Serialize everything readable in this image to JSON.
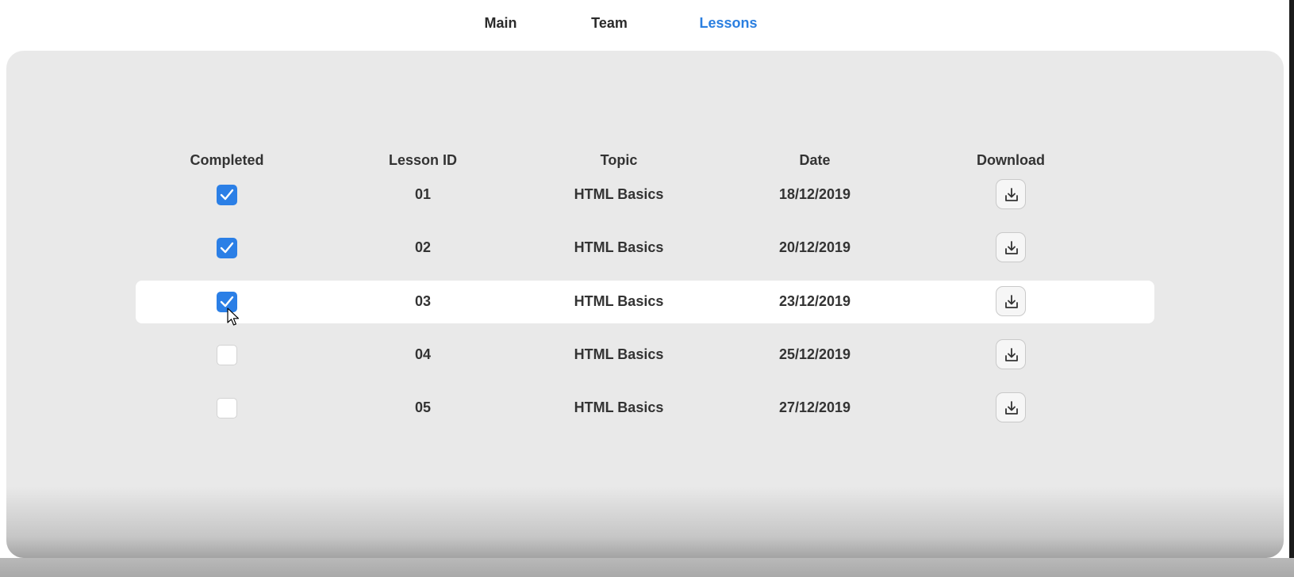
{
  "nav": {
    "tabs": [
      {
        "label": "Main",
        "active": false
      },
      {
        "label": "Team",
        "active": false
      },
      {
        "label": "Lessons",
        "active": true
      }
    ],
    "active_color": "#2b7fe0"
  },
  "table": {
    "headers": [
      "Completed",
      "Lesson ID",
      "Topic",
      "Date",
      "Download"
    ],
    "rows": [
      {
        "completed": true,
        "lesson_id": "01",
        "topic": "HTML Basics",
        "date": "18/12/2019",
        "download_icon": "download-icon"
      },
      {
        "completed": true,
        "lesson_id": "02",
        "topic": "HTML Basics",
        "date": "20/12/2019",
        "download_icon": "download-icon"
      },
      {
        "completed": true,
        "lesson_id": "03",
        "topic": "HTML Basics",
        "date": "23/12/2019",
        "download_icon": "download-icon",
        "hovered": true
      },
      {
        "completed": false,
        "lesson_id": "04",
        "topic": "HTML Basics",
        "date": "25/12/2019",
        "download_icon": "download-icon"
      },
      {
        "completed": false,
        "lesson_id": "05",
        "topic": "HTML Basics",
        "date": "27/12/2019",
        "download_icon": "download-icon"
      }
    ]
  },
  "colors": {
    "checkbox_checked": "#2b7fe6",
    "panel_background": "#e9e9e9",
    "text": "#333333"
  }
}
